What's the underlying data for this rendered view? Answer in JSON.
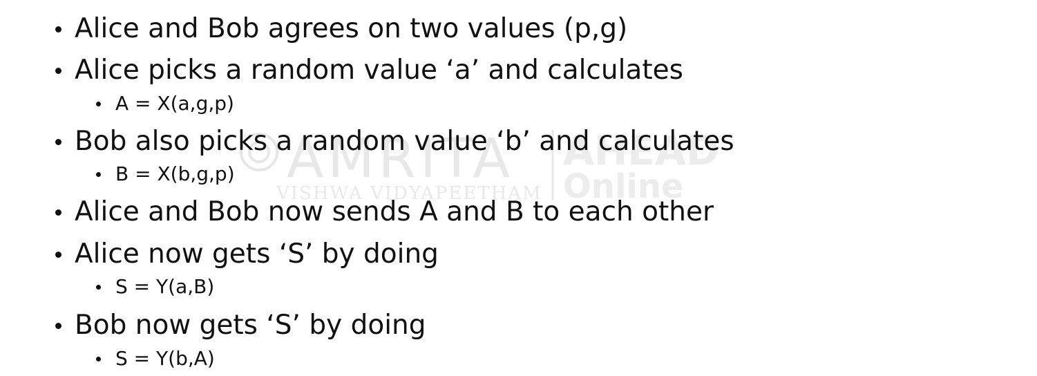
{
  "watermark": {
    "brand": "AMRITA",
    "subtitle": "VISHWA VIDYAPEETHAM",
    "right_top": "AHEAD",
    "right_bottom": "Online",
    "color": "#e6e6e6"
  },
  "bullets": [
    {
      "level": 1,
      "text": "Alice and Bob agrees on two values (p,g)"
    },
    {
      "level": 1,
      "text": "Alice picks a random value ‘a’ and calculates"
    },
    {
      "level": 2,
      "text": "A = X(a,g,p)"
    },
    {
      "level": 1,
      "text": "Bob also picks a random value ‘b’ and calculates"
    },
    {
      "level": 2,
      "text": "B = X(b,g,p)"
    },
    {
      "level": 1,
      "text": "Alice and Bob now sends  A and B to each other"
    },
    {
      "level": 1,
      "text": "Alice now gets ‘S’ by doing"
    },
    {
      "level": 2,
      "text": "S = Y(a,B)"
    },
    {
      "level": 1,
      "text": "Bob now gets ‘S’ by doing"
    },
    {
      "level": 2,
      "text": "S = Y(b,A)"
    }
  ]
}
